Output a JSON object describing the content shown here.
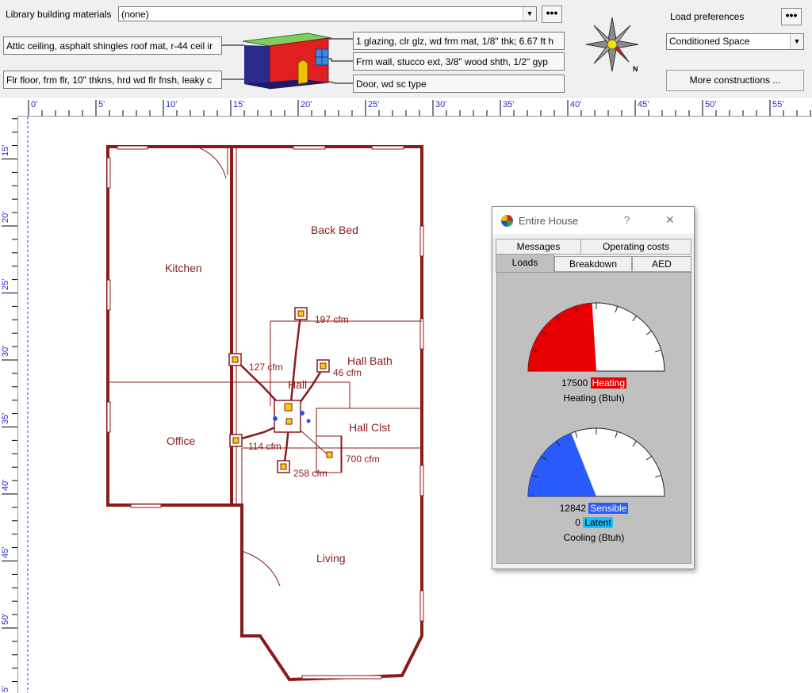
{
  "toolbar": {
    "library_label": "Library building materials",
    "library_value": "(none)",
    "roof": "Attic ceiling, asphalt shingles roof mat, r-44 ceil ir",
    "floor": "Flr floor, frm flr, 10\" thkns, hrd wd flr fnsh, leaky c",
    "glazing": "1 glazing, clr glz, wd frm mat, 1/8\" thk; 6.67 ft h",
    "wall": "Frm wall, stucco ext, 3/8\" wood shth, 1/2\" gyp",
    "door": "Door, wd sc type",
    "compass_north": "N",
    "load_pref_label": "Load preferences",
    "load_pref_value": "Conditioned Space",
    "more_constructions": "More constructions ...",
    "dots": "•••"
  },
  "ruler": {
    "top": [
      "0'",
      "5'",
      "10'",
      "15'",
      "20'",
      "25'",
      "30'",
      "35'",
      "40'",
      "45'",
      "50'",
      "55'"
    ],
    "left": [
      "15'",
      "20'",
      "25'",
      "30'",
      "35'",
      "40'",
      "45'",
      "50'",
      "5'"
    ]
  },
  "rooms": {
    "kitchen": "Kitchen",
    "back_bed": "Back Bed",
    "hall_bath": "Hall Bath",
    "hall": "Hall",
    "hall_clst": "Hall Clst",
    "office": "Office",
    "living": "Living"
  },
  "airflow": {
    "back_bed": "197 cfm",
    "kitchen": "127 cfm",
    "hall_bath": "46 cfm",
    "office": "114 cfm",
    "living": "258 cfm",
    "return": "700 cfm"
  },
  "window": {
    "title": "Entire House",
    "help": "?",
    "close": "✕",
    "tabs_row1": [
      "Messages",
      "Operating costs"
    ],
    "tabs_row2": [
      "Loads",
      "Breakdown",
      "AED"
    ],
    "active_tab": "Loads",
    "heating": {
      "value": "17500",
      "badge": "Heating",
      "caption": "Heating (Btuh)",
      "fraction": 0.48,
      "color": "#e80000"
    },
    "cooling": {
      "sensible_value": "12842",
      "sensible_badge": "Sensible",
      "latent_value": "0",
      "latent_badge": "Latent",
      "caption": "Cooling (Btuh)",
      "fraction": 0.38,
      "sensible_color": "#2a5bff",
      "latent_color": "#19c0ff"
    }
  },
  "colors": {
    "wall": "#8b1a1a",
    "ruler_text": "#2a2ad0",
    "ruler_guide": "#2a2ad0",
    "panel_bg": "#c0c0c0"
  }
}
